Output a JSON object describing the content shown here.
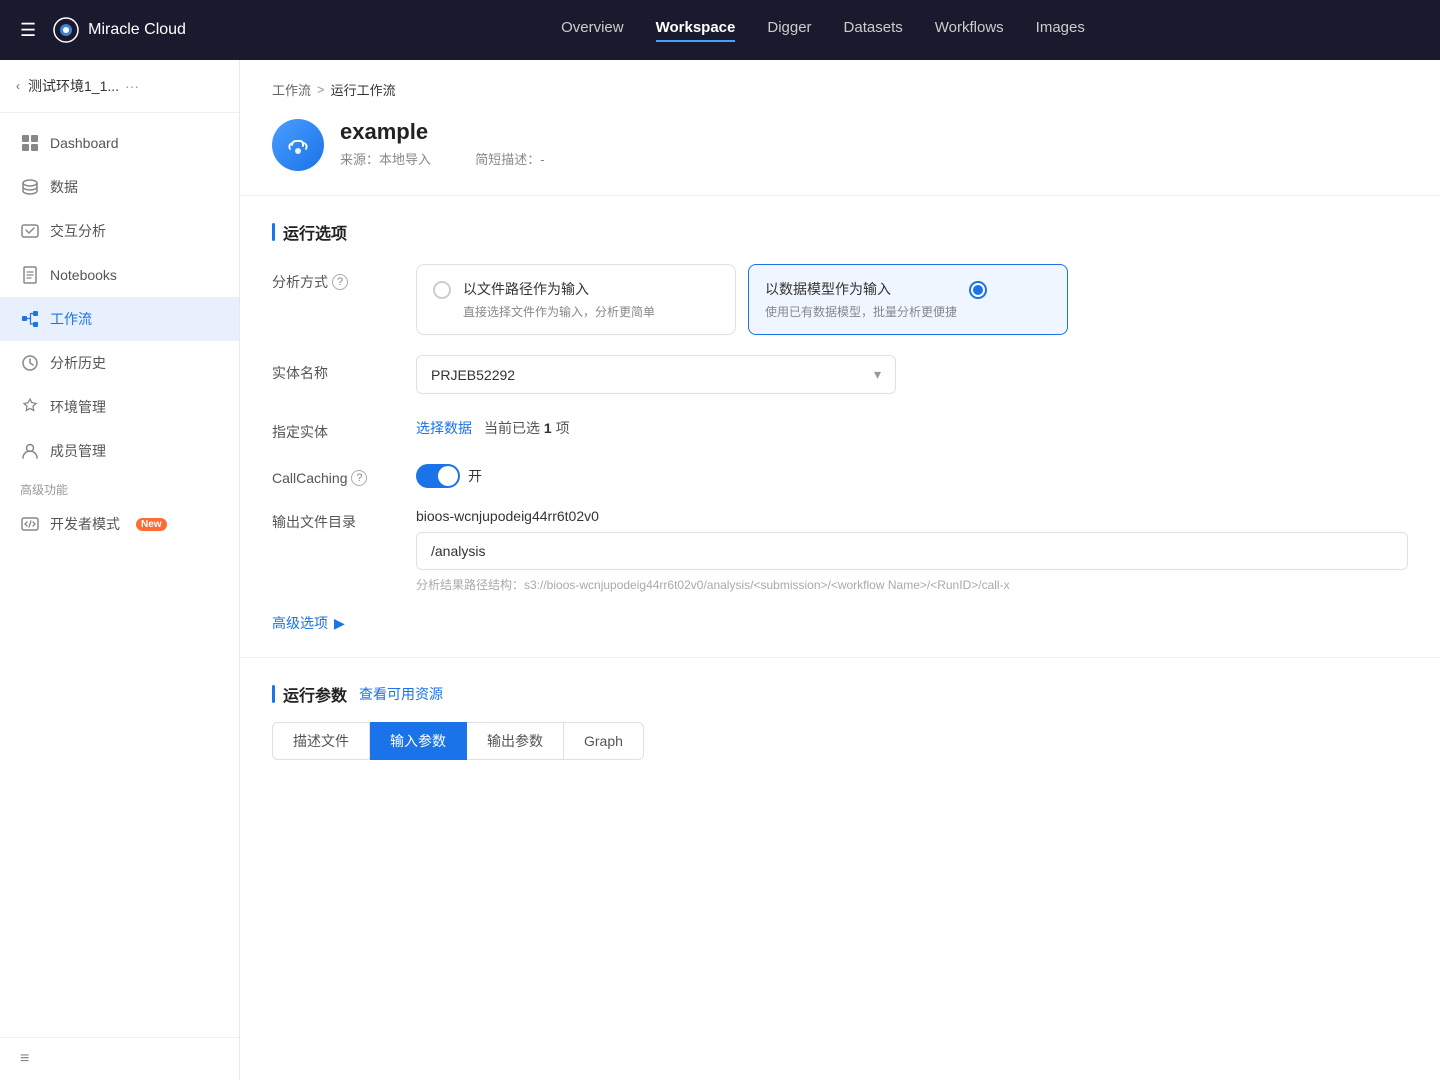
{
  "topNav": {
    "menuIcon": "☰",
    "logoIcon": "⚙",
    "logoText": "Miracle Cloud",
    "links": [
      {
        "label": "Overview",
        "active": false
      },
      {
        "label": "Workspace",
        "active": true
      },
      {
        "label": "Digger",
        "active": false
      },
      {
        "label": "Datasets",
        "active": false
      },
      {
        "label": "Workflows",
        "active": false
      },
      {
        "label": "Images",
        "active": false
      }
    ]
  },
  "sidebar": {
    "envName": "测试环境1_1...···",
    "items": [
      {
        "label": "Dashboard",
        "icon": "▣",
        "active": false
      },
      {
        "label": "数据",
        "icon": "🗄",
        "active": false
      },
      {
        "label": "交互分析",
        "icon": "⌨",
        "active": false
      },
      {
        "label": "Notebooks",
        "icon": "⌨",
        "active": false
      },
      {
        "label": "工作流",
        "icon": "◈",
        "active": true
      },
      {
        "label": "分析历史",
        "icon": "✓",
        "active": false
      },
      {
        "label": "环境管理",
        "icon": "◉",
        "active": false
      },
      {
        "label": "成员管理",
        "icon": "👤",
        "active": false
      }
    ],
    "advancedLabel": "高级功能",
    "devModeLabel": "开发者模式",
    "devModeBadge": "New"
  },
  "breadcrumb": {
    "parent": "工作流",
    "sep": ">",
    "current": "运行工作流"
  },
  "header": {
    "workflowName": "example",
    "sourceLabel": "来源：本地导入",
    "descLabel": "简短描述：-"
  },
  "runOptions": {
    "sectionTitle": "运行选项",
    "analysisMethodLabel": "分析方式",
    "helpIcon": "?",
    "card1Title": "以文件路径作为输入",
    "card1Desc": "直接选择文件作为输入，分析更简单",
    "card2Title": "以数据模型作为输入",
    "card2Desc": "使用已有数据模型，批量分析更便捷",
    "entityNameLabel": "实体名称",
    "entityValue": "PRJEB52292",
    "specifyEntityLabel": "指定实体",
    "selectDataLink": "选择数据",
    "selectedCountText": "当前已选",
    "selectedCountNum": "1",
    "selectedCountSuffix": "项",
    "callCachingLabel": "CallCaching",
    "callCachingToggleLabel": "开",
    "outputDirLabel": "输出文件目录",
    "outputBucket": "bioos-wcnjupodeig44rr6t02v0",
    "outputPath": "/analysis",
    "outputHint": "分析结果路径结构：s3://bioos-wcnjupodeig44rr6t02v0/analysis/<submission>/<workflow Name>/<RunID>/call-x",
    "advancedOptionsLabel": "高级选项",
    "advancedArrow": "▶"
  },
  "runParams": {
    "sectionTitle": "运行参数",
    "viewResourcesLink": "查看可用资源",
    "tabs": [
      {
        "label": "描述文件",
        "active": false
      },
      {
        "label": "输入参数",
        "active": true
      },
      {
        "label": "输出参数",
        "active": false
      },
      {
        "label": "Graph",
        "active": false
      }
    ]
  },
  "footerIcon": "≡"
}
